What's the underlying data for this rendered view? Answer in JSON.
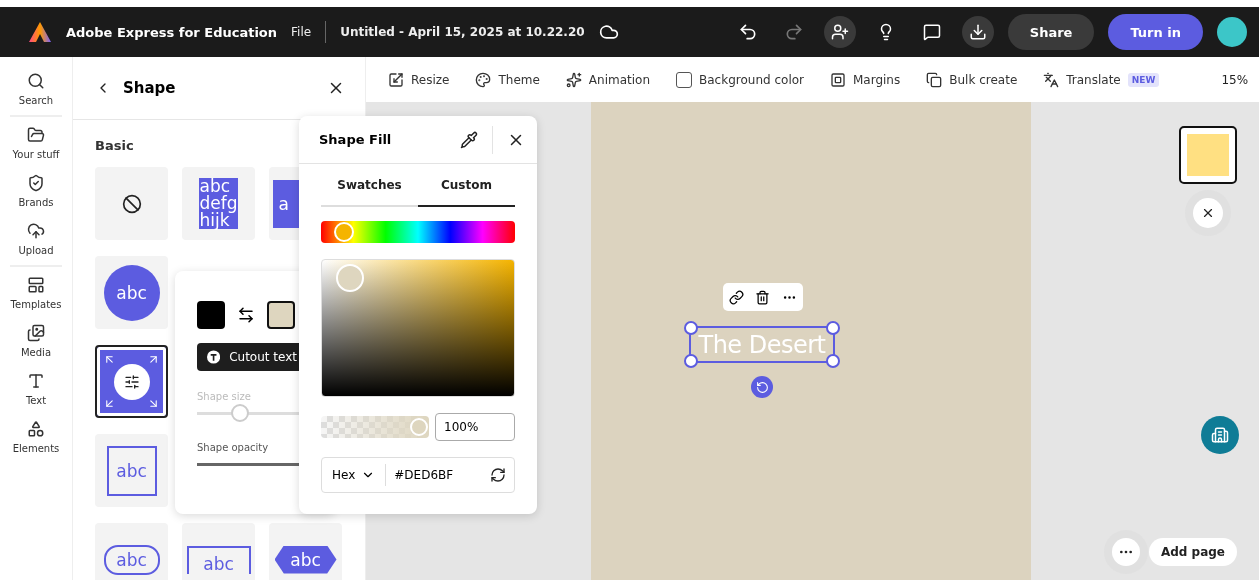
{
  "header": {
    "app_name": "Adobe Express for Education",
    "menu": "File",
    "document_title": "Untitled - April 15, 2025 at 10.22.20",
    "undo_disabled": false,
    "redo_disabled": true,
    "share": "Share",
    "turn_in": "Turn in"
  },
  "rail": [
    [
      {
        "label": "Search"
      }
    ],
    [
      {
        "label": "Your stuff"
      },
      {
        "label": "Brands"
      },
      {
        "label": "Upload"
      }
    ],
    [
      {
        "label": "Templates"
      },
      {
        "label": "Media"
      },
      {
        "label": "Text"
      },
      {
        "label": "Elements"
      }
    ]
  ],
  "panel": {
    "title": "Shape",
    "section": "Basic",
    "tiles": [
      [
        {
          "kind": "none",
          "selected": false
        },
        {
          "kind": "highlight",
          "lines": [
            "abc",
            "defg",
            "hijk"
          ],
          "selected": false
        },
        {
          "kind": "block",
          "lines": [
            "a"
          ],
          "selected": false
        }
      ],
      [
        {
          "kind": "circle",
          "lines": [
            "abc"
          ],
          "selected": false
        }
      ],
      [
        {
          "kind": "adjust",
          "selected": true
        }
      ],
      [
        {
          "kind": "square",
          "lines": [
            "abc"
          ],
          "selected": false
        }
      ],
      [
        {
          "kind": "pill",
          "lines": [
            "abc"
          ],
          "selected": false
        },
        {
          "kind": "bracket",
          "lines": [
            "abc"
          ],
          "selected": false
        },
        {
          "kind": "hexagon",
          "lines": [
            "abc"
          ],
          "selected": false
        }
      ]
    ]
  },
  "style_popover": {
    "swatches": [
      {
        "color": "#000000",
        "selected": false
      },
      {
        "color": "#ded6bf",
        "selected": true
      }
    ],
    "cutout": "Cutout text",
    "sliders": [
      {
        "label": "Shape size",
        "disabled": true,
        "level": 0.3
      },
      {
        "label": "Shape opacity",
        "disabled": false,
        "level": 1
      }
    ]
  },
  "fill_popover": {
    "title": "Shape Fill",
    "tabs": [
      {
        "label": "Swatches",
        "selected": false
      },
      {
        "label": "Custom",
        "selected": true
      }
    ],
    "hue": {
      "level": 0.12
    },
    "alpha": {
      "level": 1
    },
    "alpha_value": "100%",
    "format": "Hex",
    "hex": "#DED6BF"
  },
  "toolbar": [
    {
      "kind": "action",
      "label": "Resize"
    },
    {
      "kind": "action",
      "label": "Theme"
    },
    {
      "kind": "action",
      "label": "Animation"
    },
    {
      "kind": "checkbox",
      "label": "Background color",
      "checked": false
    },
    {
      "kind": "action",
      "label": "Margins"
    },
    {
      "kind": "action",
      "label": "Bulk create"
    },
    {
      "kind": "action",
      "label": "Translate",
      "badge": "NEW"
    }
  ],
  "zoom": "15%",
  "canvas": {
    "text": "The Desert",
    "selected": true
  },
  "pages": [
    {
      "selected": true,
      "color": "#ffe082"
    }
  ],
  "add_page": "Add page"
}
